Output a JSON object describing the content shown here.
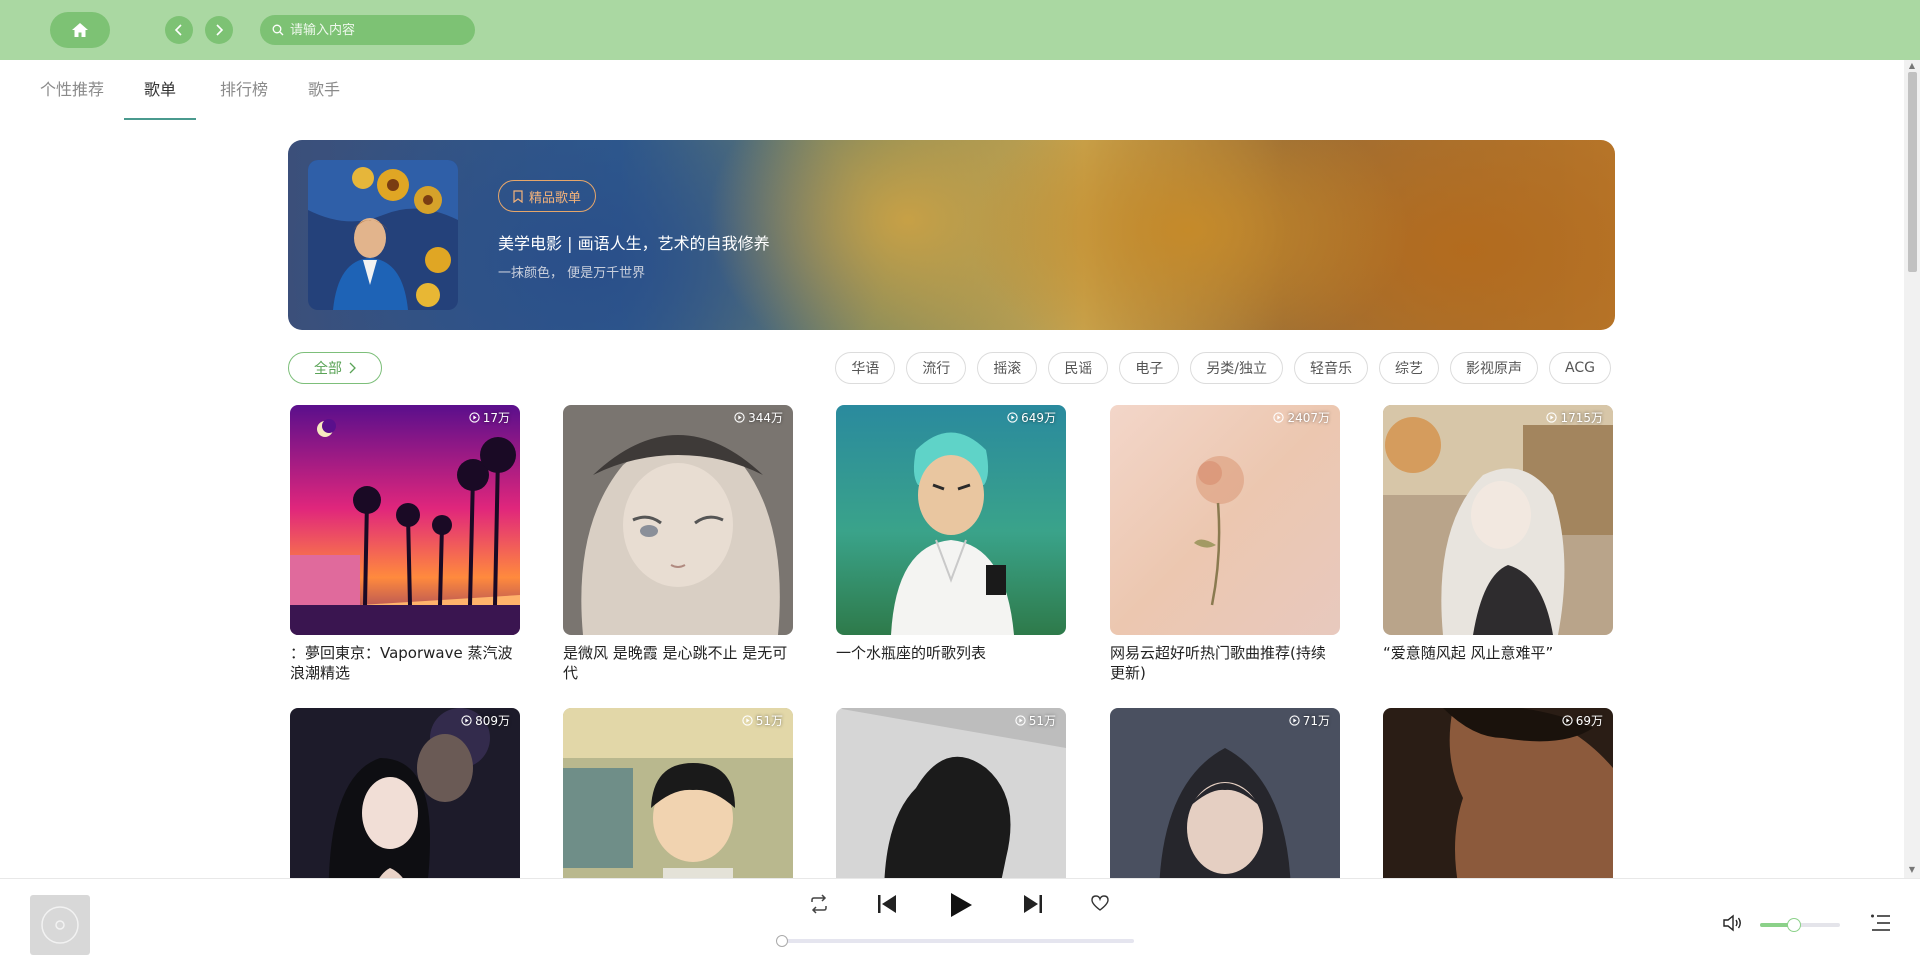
{
  "header": {
    "search_placeholder": "请输入内容",
    "home_icon": "home-icon",
    "back_icon": "chevron-left-icon",
    "forward_icon": "chevron-right-icon"
  },
  "tabs": [
    {
      "label": "个性推荐",
      "active": false
    },
    {
      "label": "歌单",
      "active": true
    },
    {
      "label": "排行榜",
      "active": false
    },
    {
      "label": "歌手",
      "active": false
    }
  ],
  "banner": {
    "tag": "精品歌单",
    "title": "美学电影 | 画语人生，艺术的自我修养",
    "subtitle": "一抹颜色， 便是万千世界"
  },
  "filters": {
    "all_label": "全部",
    "categories": [
      "华语",
      "流行",
      "摇滚",
      "民谣",
      "电子",
      "另类/独立",
      "轻音乐",
      "综艺",
      "影视原声",
      "ACG"
    ]
  },
  "playlists": [
    {
      "title": "：夢回東京：Vaporwave 蒸汽波浪潮精选",
      "plays": "17万"
    },
    {
      "title": "是微风 是晚霞 是心跳不止 是无可代",
      "plays": "344万"
    },
    {
      "title": "一个水瓶座的听歌列表",
      "plays": "649万"
    },
    {
      "title": "网易云超好听热门歌曲推荐(持续更新)",
      "plays": "2407万"
    },
    {
      "title": "“爱意随风起 风止意难平”",
      "plays": "1715万"
    },
    {
      "title": "",
      "plays": "809万"
    },
    {
      "title": "",
      "plays": "51万"
    },
    {
      "title": "",
      "plays": "51万"
    },
    {
      "title": "",
      "plays": "71万"
    },
    {
      "title": "",
      "plays": "69万"
    }
  ],
  "player": {
    "progress": 0,
    "volume": 0.5
  },
  "colors": {
    "accent": "#aad8a2",
    "accent_dark": "#7dc274",
    "tab_underline": "#4a9a8e"
  }
}
